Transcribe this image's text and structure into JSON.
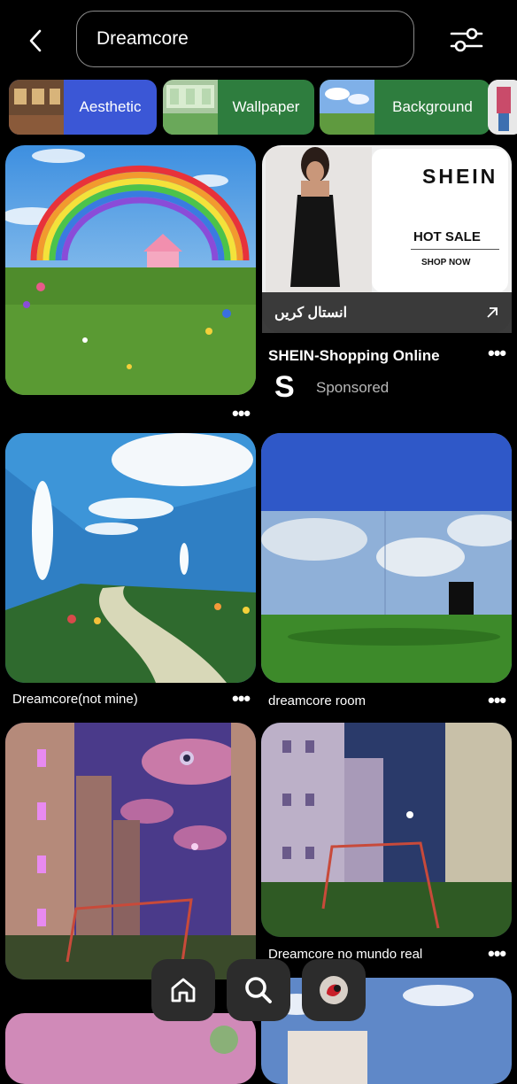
{
  "header": {
    "back_icon": "chevron-left-icon",
    "search_value": "Dreamcore",
    "filter_icon": "sliders-icon"
  },
  "chips": [
    {
      "label": "Aesthetic",
      "color": "#3b57d6"
    },
    {
      "label": "Wallpaper",
      "color": "#2e7d3e"
    },
    {
      "label": "Background",
      "color": "#2e7d3e"
    }
  ],
  "ad": {
    "brand_banner": "SHEIN",
    "hot_sale": "HOT SALE",
    "shop_now": "SHOP NOW",
    "cta": "انستال کریں",
    "title": "SHEIN-Shopping Online",
    "brand_letter": "S",
    "sponsored": "Sponsored"
  },
  "pins": [
    {
      "caption": ""
    },
    {
      "caption": "Dreamcore(not mine)"
    },
    {
      "caption": "dreamcore room"
    },
    {
      "caption": ""
    },
    {
      "caption": "Dreamcore no mundo real"
    }
  ],
  "more_label": "•••",
  "nav": {
    "home_icon": "home-icon",
    "search_icon": "search-icon",
    "profile_icon": "avatar"
  }
}
